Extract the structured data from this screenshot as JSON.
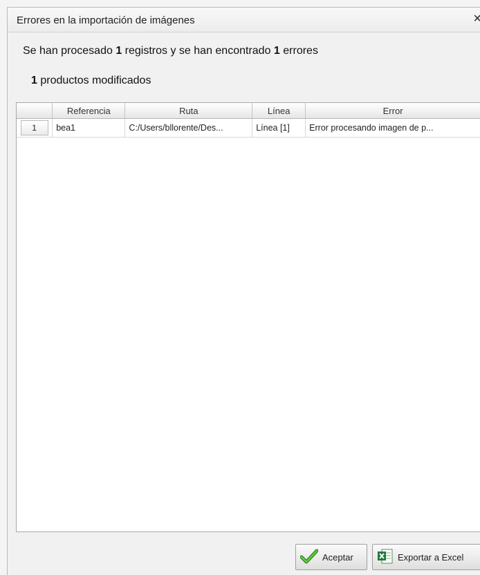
{
  "dialog": {
    "title": "Errores en la importación de imágenes",
    "close_label": "×"
  },
  "summary": {
    "part1": "Se han procesado ",
    "processed_count": "1",
    "part2": " registros y se han encontrado ",
    "error_count": "1",
    "part3": " errores",
    "modified_count": "1",
    "modified_text": " productos modificados"
  },
  "table": {
    "columns": [
      "",
      "Referencia",
      "Ruta",
      "Línea",
      "Error"
    ],
    "rows": [
      {
        "num": "1",
        "referencia": "bea1",
        "ruta": "C:/Users/bllorente/Des...",
        "linea": "Línea [1]",
        "error": "Error procesando imagen de p..."
      }
    ]
  },
  "buttons": {
    "accept_label": "Aceptar",
    "accept_icon": "checkmark-icon",
    "export_label": "Exportar a Excel",
    "export_icon": "excel-icon"
  }
}
